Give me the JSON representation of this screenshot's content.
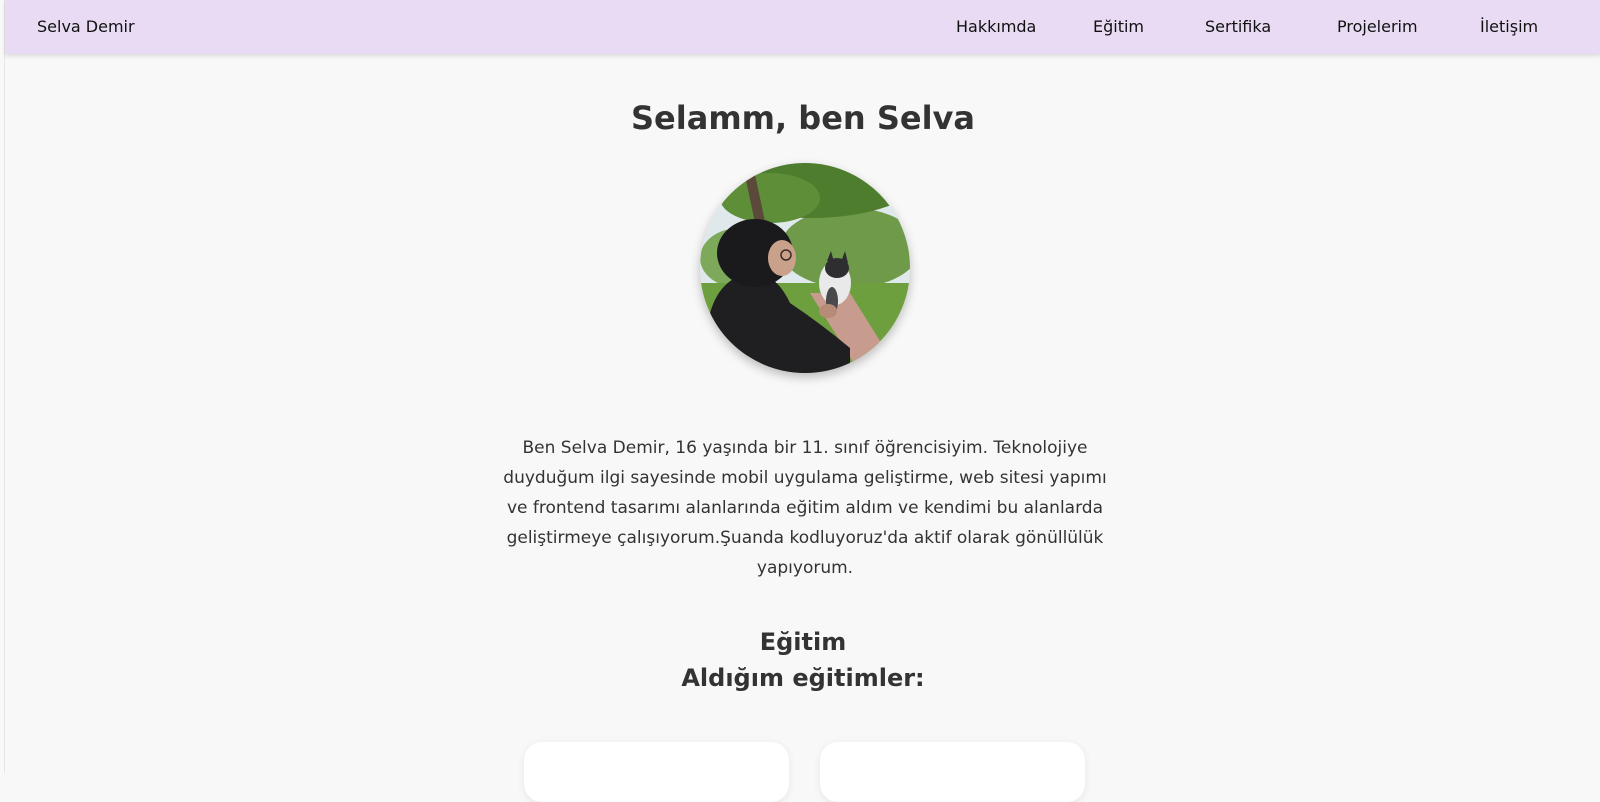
{
  "navbar": {
    "brand": "Selva Demir",
    "links": [
      "Hakkımda",
      "Eğitim",
      "Sertifika",
      "Projelerim",
      "İletişim"
    ]
  },
  "hero": {
    "title": "Selamm, ben Selva"
  },
  "about": {
    "text": "Ben Selva Demir, 16 yaşında bir 11. sınıf öğrencisiyim. Teknolojiye duyduğum ilgi sayesinde mobil uygulama geliştirme, web sitesi yapımı ve frontend tasarımı alanlarında eğitim aldım ve kendimi bu alanlarda geliştirmeye çalışıyorum.Şuanda kodluyoruz'da aktif olarak gönüllülük yapıyorum."
  },
  "education": {
    "title": "Eğitim",
    "subtitle": "Aldığım eğitimler:"
  },
  "colors": {
    "navbar_bg": "#e8dbf3",
    "page_bg": "#f8f8f8",
    "text": "#333333"
  }
}
